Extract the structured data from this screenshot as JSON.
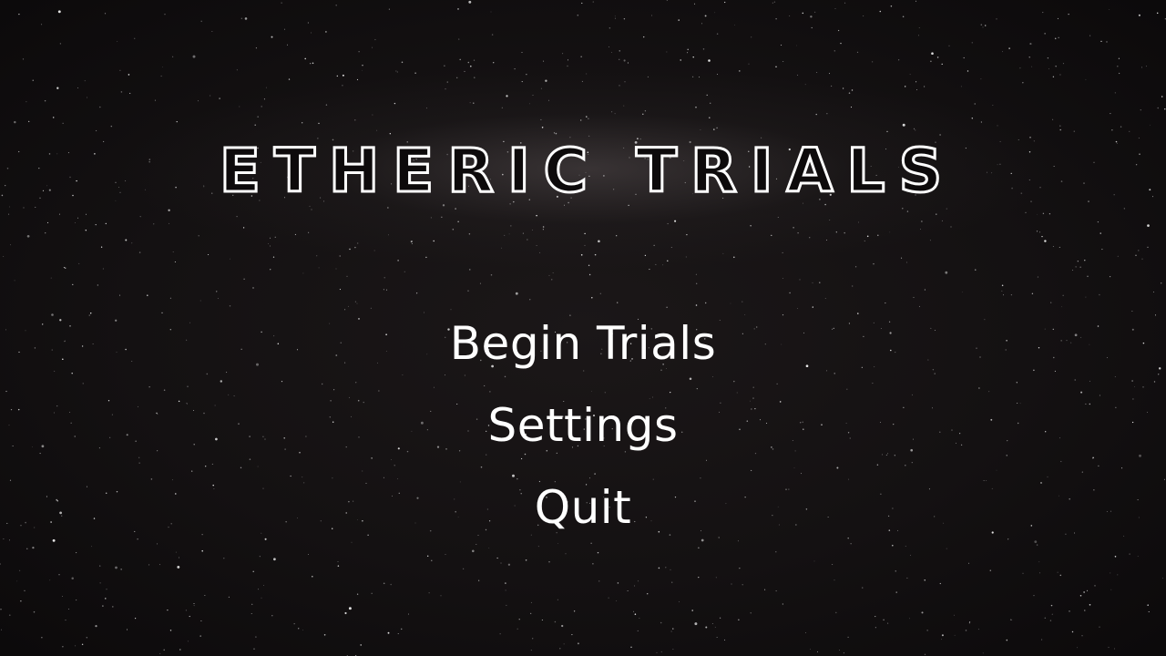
{
  "game": {
    "title": "ETHERIC TRIALS"
  },
  "menu": {
    "items": [
      {
        "label": "Begin Trials"
      },
      {
        "label": "Settings"
      },
      {
        "label": "Quit"
      }
    ]
  },
  "colors": {
    "background": "#0f0c0d",
    "text": "#ffffff",
    "title_glow": "#8a8283"
  }
}
